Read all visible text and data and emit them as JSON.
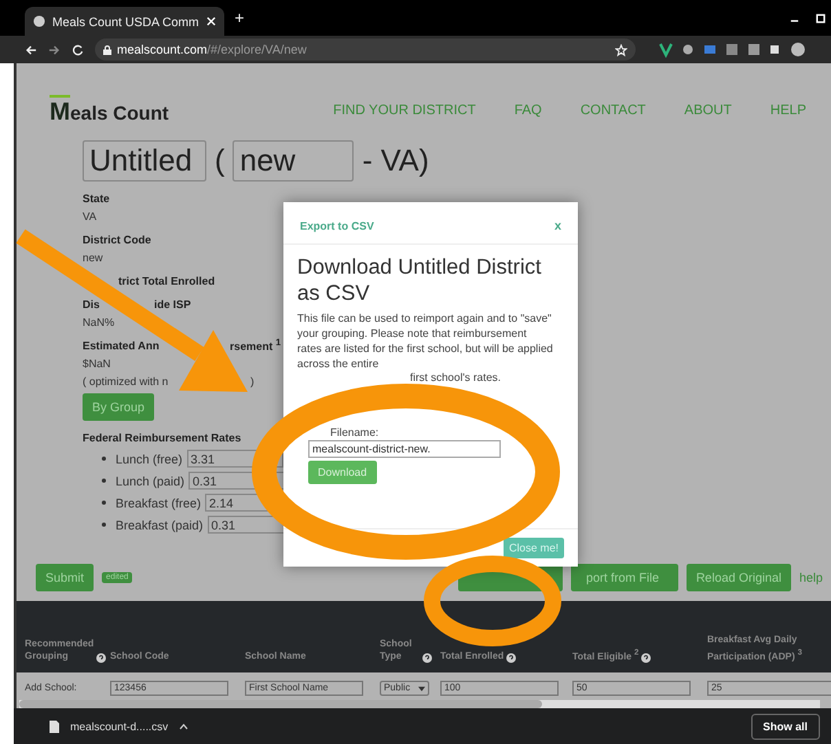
{
  "browser": {
    "tab_title": "Meals Count USDA Comm",
    "new_tab": "+",
    "url_host": "mealscount.com",
    "url_path": "/#/explore/VA/new"
  },
  "site": {
    "logo_mark": "M",
    "logo_text": "eals Count",
    "nav": [
      "FIND YOUR DISTRICT",
      "FAQ",
      "CONTACT",
      "ABOUT",
      "HELP"
    ]
  },
  "district": {
    "name": "Untitled",
    "open_paren": "(",
    "code": "new",
    "suffix": "- VA)",
    "fields": [
      {
        "label": [
          "State"
        ],
        "value": [
          "VA"
        ]
      },
      {
        "label": [
          "District Code"
        ],
        "value": [
          "new"
        ]
      },
      {
        "label": [
          "trict Total Enrolled"
        ]
      },
      {
        "label": [
          "Dis",
          "ide ISP"
        ],
        "value": [
          "NaN%"
        ]
      },
      {
        "label": [
          "Estimated Ann",
          "rsement $^{1}$"
        ],
        "value": [
          "$NaN"
        ],
        "note": [
          "( optimized with n",
          ")"
        ]
      }
    ],
    "group_button": "By Group",
    "rates_title": "Federal Reimbursement Rates",
    "rates": [
      {
        "label": "Lunch (free)",
        "value": "3.31"
      },
      {
        "label": "Lunch (paid)",
        "value": "0.31"
      },
      {
        "label": "Breakfast (free)",
        "value": "2.14"
      },
      {
        "label": "Breakfast (paid)",
        "value": "0.31"
      }
    ]
  },
  "actions": {
    "submit": "Submit",
    "badge": "edited",
    "import": "port from File",
    "reload": "Reload Original",
    "help": "help"
  },
  "table": {
    "columns": [
      {
        "label": "Recommended Grouping",
        "help": true
      },
      {
        "label": "School Code",
        "help": false
      },
      {
        "label": "School Name",
        "help": false
      },
      {
        "label": "School Type",
        "help": true
      },
      {
        "label": "Total Enrolled",
        "help": true
      },
      {
        "label": "Total Eligible $^{2}$",
        "help": true
      },
      {
        "label": "Breakfast Avg Daily Participation (ADP) $^{3}$",
        "help": false
      }
    ],
    "add_row": {
      "label": "Add School:",
      "code": "123456",
      "name": "First School Name",
      "type": "Public",
      "enrolled": "100",
      "eligible": "50",
      "adp": "25"
    }
  },
  "modal": {
    "header": "Export to CSV",
    "close_x": "x",
    "title": "Download Untitled District as CSV",
    "text": "This file can be used to reimport again and to \"save\" your grouping. Please note that reimbursement rates are listed for the first school, but will be applied across the entire",
    "text_tail": "first school's rates.",
    "filename_label": "Filename:",
    "filename": "mealscount-district-new.",
    "download": "Download",
    "close": "Close me!"
  },
  "downloads": {
    "file": "mealscount-d.....csv",
    "show_all": "Show all"
  }
}
